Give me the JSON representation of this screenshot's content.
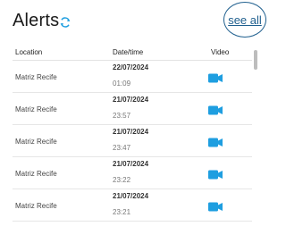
{
  "header": {
    "title": "Alerts",
    "refresh_icon": "refresh-icon",
    "see_all_label": "see all"
  },
  "table": {
    "columns": [
      "Location",
      "Date/time",
      "Video"
    ],
    "rows": [
      {
        "location": "Matriz Recife",
        "date": "22/07/2024",
        "time": "01:09",
        "video_icon": "video-camera-icon"
      },
      {
        "location": "Matriz Recife",
        "date": "21/07/2024",
        "time": "23:57",
        "video_icon": "video-camera-icon"
      },
      {
        "location": "Matriz Recife",
        "date": "21/07/2024",
        "time": "23:47",
        "video_icon": "video-camera-icon"
      },
      {
        "location": "Matriz Recife",
        "date": "21/07/2024",
        "time": "23:22",
        "video_icon": "video-camera-icon"
      },
      {
        "location": "Matriz Recife",
        "date": "21/07/2024",
        "time": "23:21",
        "video_icon": "video-camera-icon"
      }
    ]
  },
  "colors": {
    "accent": "#1f5f8e",
    "icon_blue": "#1e9ee0"
  }
}
